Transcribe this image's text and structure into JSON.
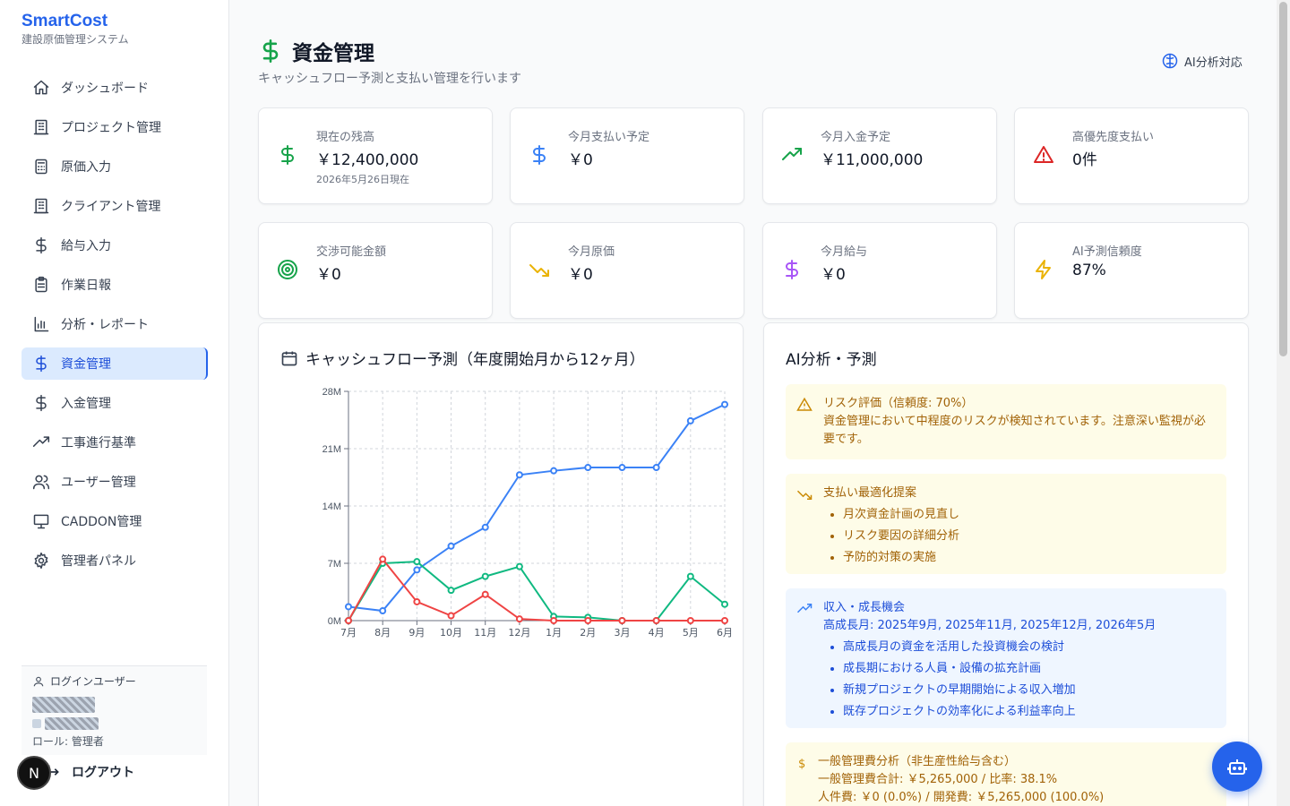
{
  "brand": {
    "title": "SmartCost",
    "subtitle": "建設原価管理システム"
  },
  "nav": [
    {
      "label": "ダッシュボード",
      "icon": "home-icon"
    },
    {
      "label": "プロジェクト管理",
      "icon": "building-icon"
    },
    {
      "label": "原価入力",
      "icon": "calculator-icon"
    },
    {
      "label": "クライアント管理",
      "icon": "building-icon"
    },
    {
      "label": "給与入力",
      "icon": "dollar-icon"
    },
    {
      "label": "作業日報",
      "icon": "clipboard-icon"
    },
    {
      "label": "分析・レポート",
      "icon": "bar-chart-icon"
    },
    {
      "label": "資金管理",
      "icon": "dollar-icon",
      "active": true
    },
    {
      "label": "入金管理",
      "icon": "dollar-icon"
    },
    {
      "label": "工事進行基準",
      "icon": "trending-up-icon"
    },
    {
      "label": "ユーザー管理",
      "icon": "users-icon"
    },
    {
      "label": "CADDON管理",
      "icon": "monitor-icon"
    },
    {
      "label": "管理者パネル",
      "icon": "gear-icon"
    }
  ],
  "user": {
    "label": "ログインユーザー",
    "role": "ロール: 管理者",
    "logout": "ログアウト",
    "avatar": "N"
  },
  "page": {
    "title": "資金管理",
    "subtitle": "キャッシュフロー予測と支払い管理を行います",
    "ai_badge": "AI分析対応"
  },
  "cards": [
    {
      "label": "現在の残高",
      "value": "￥12,400,000",
      "note": "2026年5月26日現在",
      "icon": "dollar-icon",
      "color": "#16a34a"
    },
    {
      "label": "今月支払い予定",
      "value": "￥0",
      "icon": "dollar-icon",
      "color": "#3b82f6"
    },
    {
      "label": "今月入金予定",
      "value": "￥11,000,000",
      "icon": "trending-up-icon",
      "color": "#16a34a"
    },
    {
      "label": "高優先度支払い",
      "value": "0件",
      "icon": "alert-triangle-icon",
      "color": "#dc2626"
    },
    {
      "label": "交渉可能金額",
      "value": "￥0",
      "icon": "target-icon",
      "color": "#16a34a"
    },
    {
      "label": "今月原価",
      "value": "￥0",
      "icon": "trending-down-icon",
      "color": "#eab308"
    },
    {
      "label": "今月給与",
      "value": "￥0",
      "icon": "dollar-icon",
      "color": "#a855f7"
    },
    {
      "label": "AI予測信頼度",
      "value": "87%",
      "icon": "zap-icon",
      "color": "#eab308"
    }
  ],
  "chart_panel": {
    "title": "キャッシュフロー予測（年度開始月から12ヶ月）"
  },
  "chart_data": {
    "type": "line",
    "categories": [
      "7月",
      "8月",
      "9月",
      "10月",
      "11月",
      "12月",
      "1月",
      "2月",
      "3月",
      "4月",
      "5月",
      "6月"
    ],
    "y_ticks": [
      "0M",
      "7M",
      "14M",
      "21M",
      "28M"
    ],
    "ylim": [
      0,
      28
    ],
    "grid": true,
    "series": [
      {
        "color": "#3b82f6",
        "values": [
          1.7,
          1.2,
          6.2,
          9.1,
          11.4,
          17.8,
          18.3,
          18.7,
          18.7,
          18.7,
          24.4,
          26.4
        ]
      },
      {
        "color": "#10b981",
        "values": [
          0,
          7.0,
          7.2,
          3.7,
          5.4,
          6.6,
          0.5,
          0.4,
          0,
          0,
          5.4,
          2.0
        ]
      },
      {
        "color": "#ef4444",
        "values": [
          0,
          7.5,
          2.3,
          0.6,
          3.2,
          0.2,
          0,
          0,
          0,
          0,
          0,
          0
        ]
      }
    ]
  },
  "ai_panel": {
    "title": "AI分析・予測",
    "risk": {
      "title": "リスク評価（信頼度: 70%）",
      "text": "資金管理において中程度のリスクが検知されています。注意深い監視が必要です。"
    },
    "optimize": {
      "title": "支払い最適化提案",
      "items": [
        "月次資金計画の見直し",
        "リスク要因の詳細分析",
        "予防的対策の実施"
      ]
    },
    "growth": {
      "title": "収入・成長機会",
      "text": "高成長月: 2025年9月, 2025年11月, 2025年12月, 2026年5月",
      "items": [
        "高成長月の資金を活用した投資機会の検討",
        "成長期における人員・設備の拡充計画",
        "新規プロジェクトの早期開始による収入増加",
        "既存プロジェクトの効率化による利益率向上"
      ]
    },
    "overhead": {
      "title": "一般管理費分析（非生産性給与含む）",
      "line1": "一般管理費合計: ￥5,265,000 / 比率: 38.1%",
      "line2": "人件費: ￥0 (0.0%) / 開発費: ￥5,265,000 (100.0%)"
    }
  }
}
